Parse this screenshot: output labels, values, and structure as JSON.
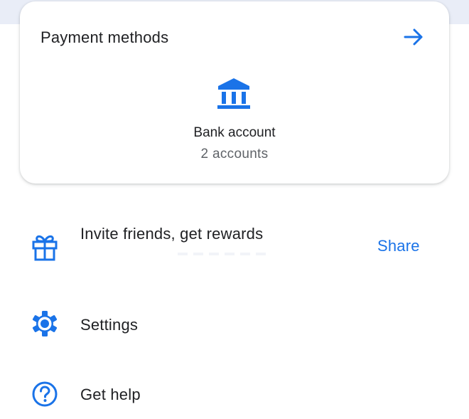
{
  "payment_card": {
    "title": "Payment methods",
    "arrow_icon": "arrow-right-icon",
    "bank_icon": "bank-icon",
    "method_label": "Bank account",
    "method_count": "2 accounts"
  },
  "menu": {
    "invite": {
      "label": "Invite friends, get rewards",
      "action": "Share",
      "icon": "gift-icon"
    },
    "settings": {
      "label": "Settings",
      "icon": "gear-icon"
    },
    "help": {
      "label": "Get help",
      "icon": "help-icon"
    }
  },
  "colors": {
    "accent": "#1a73e8",
    "text": "#202124",
    "secondary_text": "#5f6368",
    "top_band": "#e9edf7"
  }
}
